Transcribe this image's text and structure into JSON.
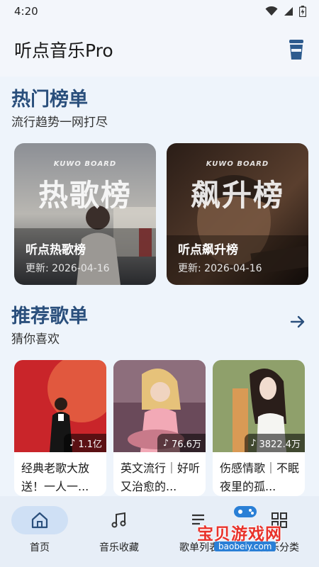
{
  "status_bar": {
    "time": "4:20"
  },
  "header": {
    "title": "听点音乐Pro",
    "icon": "cup-icon"
  },
  "hot_charts": {
    "title": "热门榜单",
    "subtitle": "流行趋势一网打尽",
    "cards": [
      {
        "board_tag": "KUWO BOARD",
        "big_text": "热歌榜",
        "name": "听点热歌榜",
        "updated": "更新: 2026-04-16"
      },
      {
        "board_tag": "KUWO BOARD",
        "big_text": "飙升榜",
        "name": "听点飙升榜",
        "updated": "更新: 2026-04-16"
      }
    ]
  },
  "recommended": {
    "title": "推荐歌单",
    "subtitle": "猜你喜欢",
    "more_icon": "arrow-right-icon",
    "playlists": [
      {
        "plays": "1.1亿",
        "title": "经典老歌大放送！一人一..."
      },
      {
        "plays": "76.6万",
        "title": "英文流行｜好听又治愈的..."
      },
      {
        "plays": "3822.4万",
        "title": "伤感情歌｜不眠夜里的孤..."
      }
    ]
  },
  "bottom_nav": {
    "items": [
      {
        "label": "首页",
        "icon": "home-icon",
        "active": true
      },
      {
        "label": "音乐收藏",
        "icon": "music-note-icon",
        "active": false
      },
      {
        "label": "歌单列表",
        "icon": "list-icon",
        "active": false
      },
      {
        "label": "音乐分类",
        "icon": "grid-icon",
        "active": false
      }
    ]
  },
  "watermark": {
    "text": "宝贝游戏网",
    "url": "baobeiy.com"
  },
  "colors": {
    "accent": "#2a4f7c",
    "background": "#eef4fb",
    "nav_active": "#cfe0f5"
  }
}
